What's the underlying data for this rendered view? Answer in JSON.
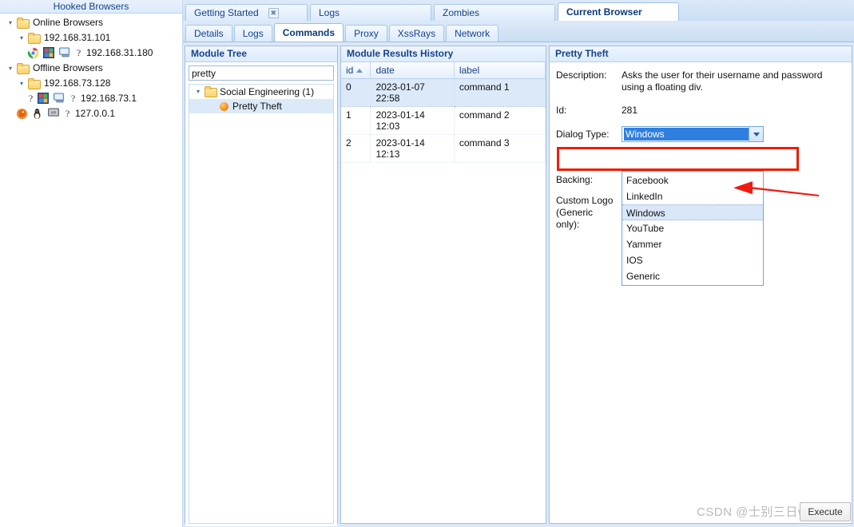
{
  "sidebar": {
    "header": "Hooked Browsers",
    "groups": [
      {
        "label": "Online Browsers",
        "hosts": [
          {
            "label": "192.168.31.101",
            "browsers": [
              {
                "ip": "192.168.31.180",
                "icons": [
                  "chrome-icon",
                  "windows-logo-icon",
                  "desktop-icon",
                  "question-mark-icon"
                ]
              }
            ]
          }
        ]
      },
      {
        "label": "Offline Browsers",
        "hosts": [
          {
            "label": "192.168.73.128",
            "browsers": [
              {
                "ip": "192.168.73.1",
                "icons": [
                  "question-mark-icon",
                  "windows-logo-icon",
                  "desktop-icon",
                  "question-mark-icon"
                ]
              },
              {
                "ip": "127.0.0.1",
                "icons": [
                  "firefox-icon",
                  "linux-penguin-icon",
                  "vm-icon",
                  "question-mark-icon"
                ]
              }
            ]
          }
        ]
      }
    ]
  },
  "outer_tabs": [
    {
      "label": "Getting Started",
      "active": false,
      "closable": true
    },
    {
      "label": "Logs",
      "active": false,
      "closable": false
    },
    {
      "label": "Zombies",
      "active": false,
      "closable": false
    },
    {
      "label": "Current Browser",
      "active": true,
      "closable": false
    }
  ],
  "inner_tabs": [
    {
      "label": "Details",
      "active": false
    },
    {
      "label": "Logs",
      "active": false
    },
    {
      "label": "Commands",
      "active": true
    },
    {
      "label": "Proxy",
      "active": false
    },
    {
      "label": "XssRays",
      "active": false
    },
    {
      "label": "Network",
      "active": false
    }
  ],
  "module_tree": {
    "title": "Module Tree",
    "search_value": "pretty",
    "search_placeholder": "",
    "nodes": [
      {
        "label": "Social Engineering (1)",
        "type": "folder",
        "expanded": true,
        "selected": false
      },
      {
        "label": "Pretty Theft",
        "type": "module",
        "selected": true
      }
    ]
  },
  "results": {
    "title": "Module Results History",
    "columns": [
      "id",
      "date",
      "label"
    ],
    "sort_column": "id",
    "sort_direction": "asc",
    "rows": [
      {
        "id": "0",
        "date_day": "2023-01-07",
        "date_time": "22:58",
        "label": "command 1",
        "selected": true
      },
      {
        "id": "1",
        "date_day": "2023-01-14",
        "date_time": "12:03",
        "label": "command 2",
        "selected": false
      },
      {
        "id": "2",
        "date_day": "2023-01-14",
        "date_time": "12:13",
        "label": "command 3",
        "selected": false
      }
    ]
  },
  "detail": {
    "title": "Pretty Theft",
    "description_label": "Description:",
    "description_value": "Asks the user for their username and password using a floating div.",
    "id_label": "Id:",
    "id_value": "281",
    "dialog_type_label": "Dialog Type:",
    "dialog_type_value": "Windows",
    "backing_label": "Backing:",
    "custom_logo_label": "Custom Logo (Generic only):",
    "dropdown_options": [
      {
        "label": "Facebook",
        "highlighted": false
      },
      {
        "label": "LinkedIn",
        "highlighted": false
      },
      {
        "label": "Windows",
        "highlighted": true
      },
      {
        "label": "YouTube",
        "highlighted": false
      },
      {
        "label": "Yammer",
        "highlighted": false
      },
      {
        "label": "IOS",
        "highlighted": false
      },
      {
        "label": "Generic",
        "highlighted": false
      }
    ],
    "execute_button": "Execute"
  },
  "annotations": {
    "highlight_color": "#f01c00",
    "arrow_color": "#ee1c11",
    "watermark": "CSDN @士别三日wyx"
  }
}
